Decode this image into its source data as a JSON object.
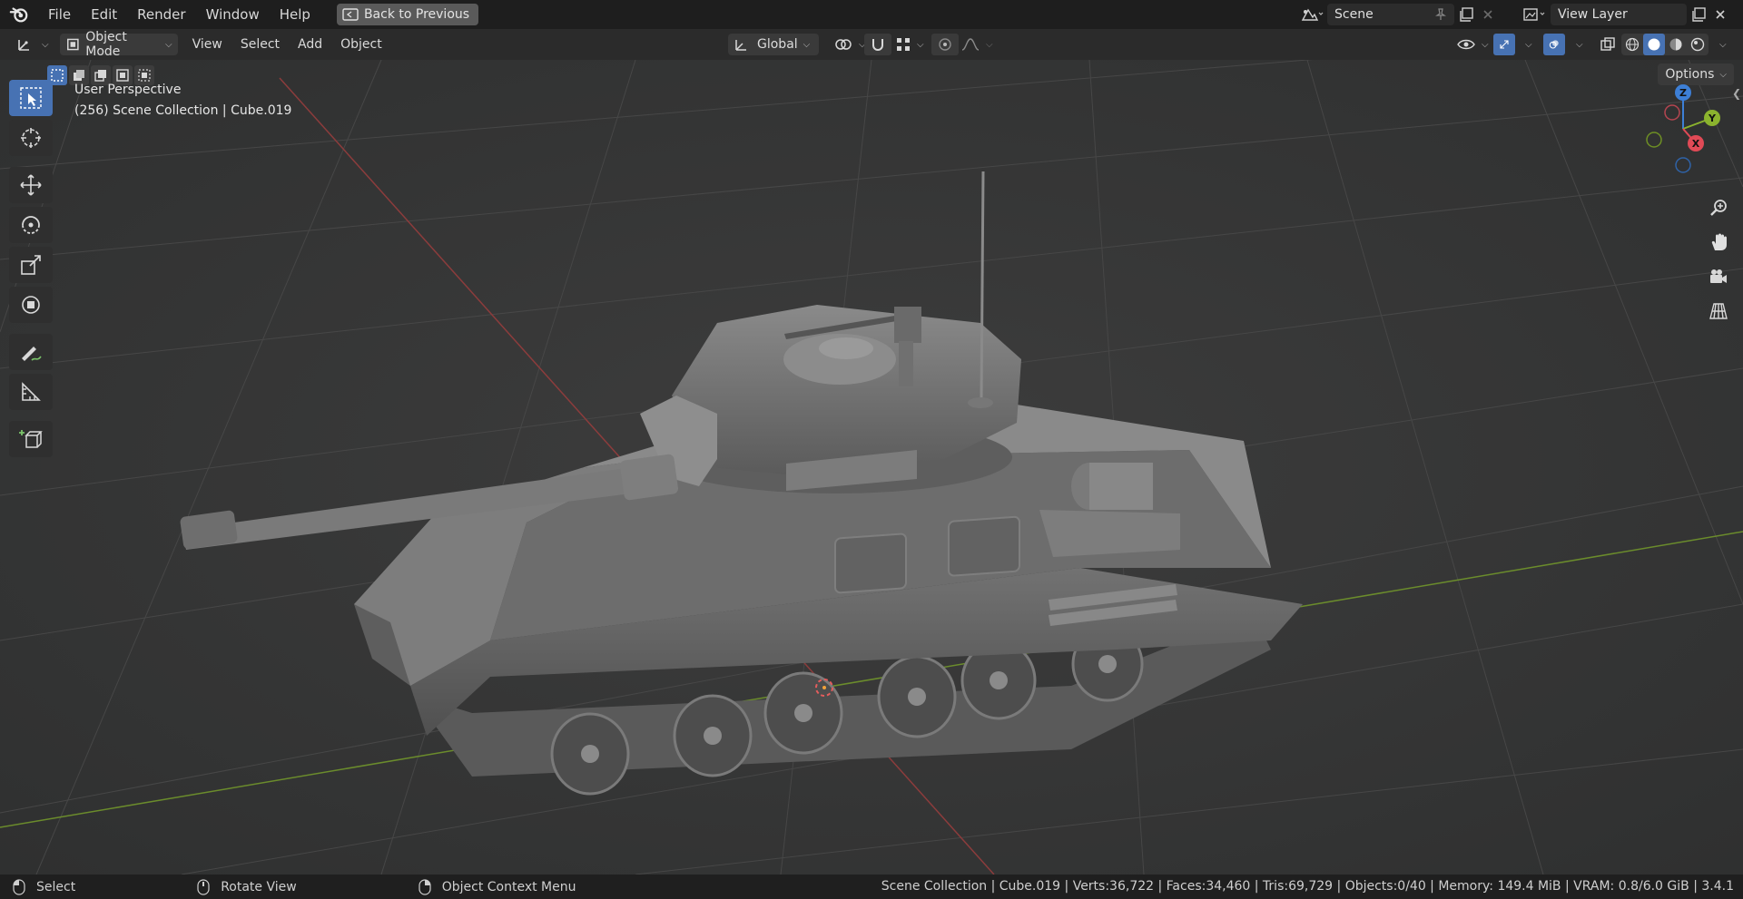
{
  "menubar": {
    "items": [
      "File",
      "Edit",
      "Render",
      "Window",
      "Help"
    ],
    "back_button": "Back to Previous",
    "scene_name": "Scene",
    "view_layer": "View Layer"
  },
  "header": {
    "mode": "Object Mode",
    "menus": [
      "View",
      "Select",
      "Add",
      "Object"
    ],
    "transform_orientation": "Global"
  },
  "viewport": {
    "options_label": "Options",
    "view_name": "User Perspective",
    "collection_info": "(256) Scene Collection | Cube.019",
    "gizmo_axes": {
      "x": "X",
      "y": "Y",
      "z": "Z"
    }
  },
  "statusbar": {
    "select": "Select",
    "rotate": "Rotate View",
    "context_menu": "Object Context Menu",
    "stats": "Scene Collection | Cube.019 | Verts:36,722 | Faces:34,460 | Tris:69,729 | Objects:0/40 | Memory: 149.4 MiB | VRAM: 0.8/6.0 GiB | 3.4.1"
  },
  "colors": {
    "accent": "#4772b3",
    "axis_x": "#e04a56",
    "axis_y": "#8bb32e",
    "axis_z": "#3d7fd6"
  }
}
